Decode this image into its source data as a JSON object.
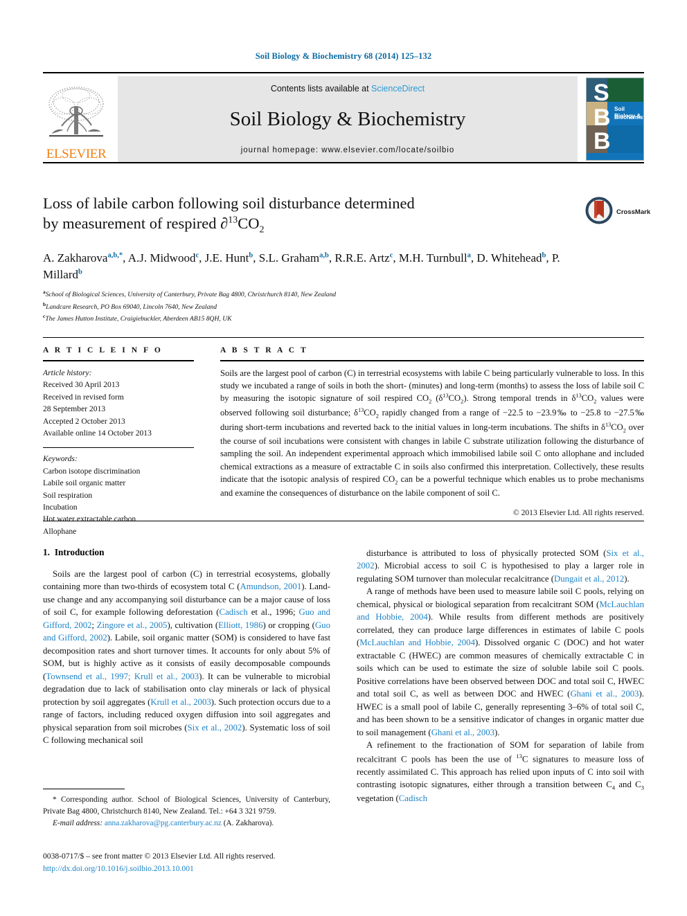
{
  "running_head": "Soil Biology & Biochemistry 68 (2014) 125–132",
  "masthead": {
    "elsevier_wordmark": "ELSEVIER",
    "contents_prefix": "Contents lists available at ",
    "contents_link": "ScienceDirect",
    "journal_title": "Soil Biology & Biochemistry",
    "homepage": "journal homepage: www.elsevier.com/locate/soilbio",
    "cover": {
      "letters": [
        "S",
        "B",
        "B"
      ],
      "title_line1": "Soil Biology &",
      "title_line2": "Biochemistry"
    }
  },
  "crossmark": {
    "label": "CrossMark"
  },
  "article": {
    "title_line1": "Loss of labile carbon following soil disturbance determined",
    "title_line2_pre": "by measurement of respired ∂",
    "title_sup": "13",
    "title_post": "CO",
    "title_sub": "2",
    "authors_html": [
      {
        "name": "A. Zakharova",
        "sup": "a,b,*"
      },
      {
        "name": "A.J. Midwood",
        "sup": "c"
      },
      {
        "name": "J.E. Hunt",
        "sup": "b"
      },
      {
        "name": "S.L. Graham",
        "sup": "a,b"
      },
      {
        "name": "R.R.E. Artz",
        "sup": "c"
      },
      {
        "name": "M.H. Turnbull",
        "sup": "a"
      },
      {
        "name": "D. Whitehead",
        "sup": "b"
      },
      {
        "name": "P. Millard",
        "sup": "b"
      }
    ],
    "affiliations": [
      {
        "marker": "a",
        "text": "School of Biological Sciences, University of Canterbury, Private Bag 4800, Christchurch 8140, New Zealand"
      },
      {
        "marker": "b",
        "text": "Landcare Research, PO Box 69040, Lincoln 7640, New Zealand"
      },
      {
        "marker": "c",
        "text": "The James Hutton Institute, Craigiebuckler, Aberdeen AB15 8QH, UK"
      }
    ]
  },
  "article_info": {
    "heading": "A R T I C L E  I N F O",
    "history_label": "Article history:",
    "history": [
      "Received 30 April 2013",
      "Received in revised form",
      "28 September 2013",
      "Accepted 2 October 2013",
      "Available online 14 October 2013"
    ],
    "keywords_label": "Keywords:",
    "keywords": [
      "Carbon isotope discrimination",
      "Labile soil organic matter",
      "Soil respiration",
      "Incubation",
      "Hot water extractable carbon",
      "Allophane"
    ]
  },
  "abstract": {
    "heading": "A B S T R A C T",
    "body_parts": [
      {
        "t": "Soils are the largest pool of carbon (C) in terrestrial ecosystems with labile C being particularly vulnerable to loss. In this study we incubated a range of soils in both the short- (minutes) and long-term (months) to assess the loss of labile soil C by measuring the isotopic signature of soil respired CO"
      },
      {
        "sub": "2"
      },
      {
        "t": " ("
      },
      {
        "t_plain": "δ"
      },
      {
        "sup": "13"
      },
      {
        "t": "CO"
      },
      {
        "sub": "2"
      },
      {
        "t": "). Strong temporal trends in "
      },
      {
        "t_plain": "δ"
      },
      {
        "sup": "13"
      },
      {
        "t": "CO"
      },
      {
        "sub": "2"
      },
      {
        "t": " values were observed following soil disturbance; "
      },
      {
        "t_plain": "δ"
      },
      {
        "sup": "13"
      },
      {
        "t": "CO"
      },
      {
        "sub": "2"
      },
      {
        "t": " rapidly changed from a range of −22.5 to −23.9‰ to −25.8 to −27.5‰ during short-term incubations and reverted back to the initial values in long-term incubations. The shifts in "
      },
      {
        "t_plain": "δ"
      },
      {
        "sup": "13"
      },
      {
        "t": "CO"
      },
      {
        "sub": "2"
      },
      {
        "t": " over the course of soil incubations were consistent with changes in labile C substrate utilization following the disturbance of sampling the soil. An independent experimental approach which immobilised labile soil C onto allophane and included chemical extractions as a measure of extractable C in soils also confirmed this interpretation. Collectively, these results indicate that the isotopic analysis of respired CO"
      },
      {
        "sub": "2"
      },
      {
        "t": " can be a powerful technique which enables us to probe mechanisms and examine the consequences of disturbance on the labile component of soil C."
      }
    ],
    "copyright": "© 2013 Elsevier Ltd. All rights reserved."
  },
  "introduction": {
    "number": "1.",
    "title": "Introduction",
    "left_col": [
      "Soils are the largest pool of carbon (C) in terrestrial ecosystems, globally containing more than two-thirds of ecosystem total C (Amundson, 2001). Land-use change and any accompanying soil disturbance can be a major cause of loss of soil C, for example following deforestation (Cadisch et al., 1996; Guo and Gifford, 2002; Zingore et al., 2005), cultivation (Elliott, 1986) or cropping (Guo and Gifford, 2002). Labile, soil organic matter (SOM) is considered to have fast decomposition rates and short turnover times. It accounts for only about 5% of SOM, but is highly active as it consists of easily decomposable compounds (Townsend et al., 1997; Krull et al., 2003). It can be vulnerable to microbial degradation due to lack of stabilisation onto clay minerals or lack of physical protection by soil aggregates (Krull et al., 2003). Such protection occurs due to a range of factors, including reduced oxygen diffusion into soil aggregates and physical separation from soil microbes (Six et al., 2002). Systematic loss of soil C following mechanical soil"
    ],
    "right_col": [
      "disturbance is attributed to loss of physically protected SOM (Six et al., 2002). Microbial access to soil C is hypothesised to play a larger role in regulating SOM turnover than molecular recalcitrance (Dungait et al., 2012).",
      "A range of methods have been used to measure labile soil C pools, relying on chemical, physical or biological separation from recalcitrant SOM (McLauchlan and Hobbie, 2004). While results from different methods are positively correlated, they can produce large differences in estimates of labile C pools (McLauchlan and Hobbie, 2004). Dissolved organic C (DOC) and hot water extractable C (HWEC) are common measures of chemically extractable C in soils which can be used to estimate the size of soluble labile soil C pools. Positive correlations have been observed between DOC and total soil C, HWEC and total soil C, as well as between DOC and HWEC (Ghani et al., 2003). HWEC is a small pool of labile C, generally representing 3–6% of total soil C, and has been shown to be a sensitive indicator of changes in organic matter due to soil management (Ghani et al., 2003).",
      "A refinement to the fractionation of SOM for separation of labile from recalcitrant C pools has been the use of 13C signatures to measure loss of recently assimilated C. This approach has relied upon inputs of C into soil with contrasting isotopic signatures, either through a transition between C4 and C3 vegetation (Cadisch"
    ],
    "citations": [
      "Amundson, 2001",
      "Cadisch et al., 1996; Guo and Gifford, 2002;",
      "Zingore et al., 2005",
      "Elliott, 1986",
      "Guo and",
      "Gifford, 2002",
      "Townsend et al., 1997; Krull et al.,",
      "2003",
      "Krull et al., 2003",
      "Six et al.,",
      "2002",
      "Six",
      "et al., 2002",
      "Dungait et al., 2012",
      "McLauchlan and Hobbie, 2004",
      "McLauchlan and",
      "Hobbie, 2004",
      "Ghani et al., 2003",
      "Cadisch"
    ]
  },
  "footnote": {
    "corresponding": "* Corresponding author. School of Biological Sciences, University of Canterbury, Private Bag 4800, Christchurch 8140, New Zealand. Tel.: +64 3 321 9759.",
    "email_label": "E-mail address:",
    "email": "anna.zakharova@pg.canterbury.ac.nz",
    "email_attrib": "(A. Zakharova)."
  },
  "issn_block": {
    "line1": "0038-0717/$ – see front matter © 2013 Elsevier Ltd. All rights reserved.",
    "doi": "http://dx.doi.org/10.1016/j.soilbio.2013.10.001"
  },
  "colors": {
    "link_blue": "#1d82c6",
    "header_blue": "#0b6ba2",
    "sciencedirect_blue": "#2a9ad6",
    "elsevier_orange": "#f07f13",
    "cover_blue": "#1274b8",
    "panel_grey": "#e6e6e6"
  }
}
